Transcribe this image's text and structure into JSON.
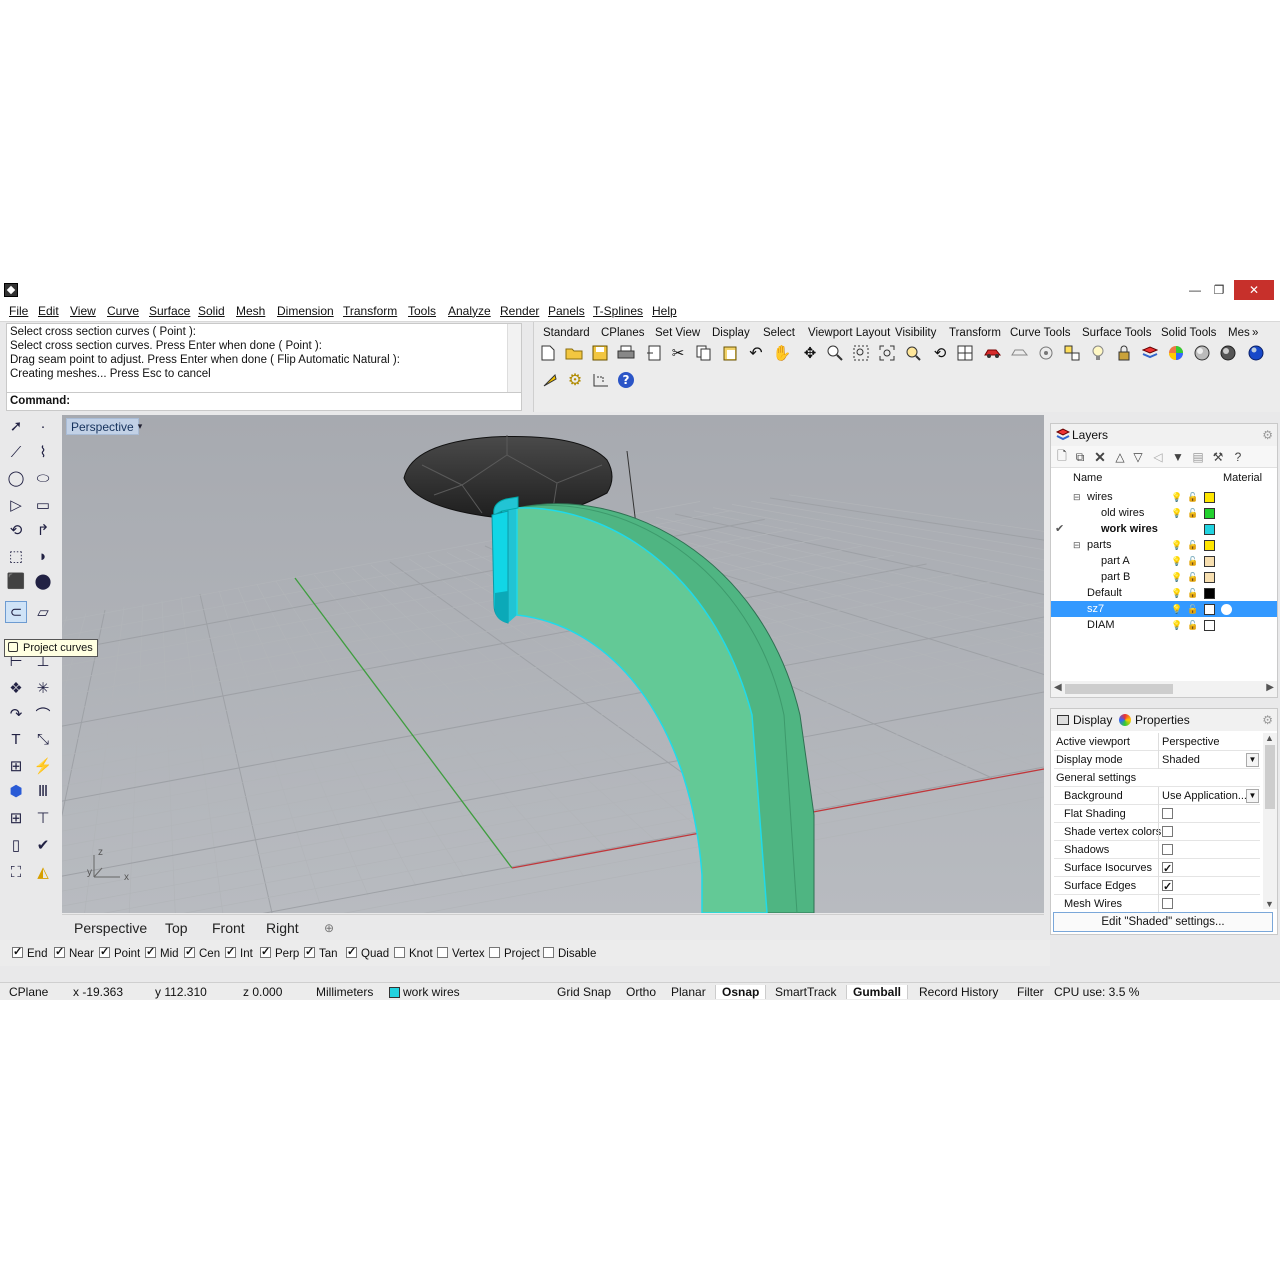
{
  "window": {
    "minimize": "—",
    "restore": "❐",
    "close": "✕"
  },
  "menu": [
    "File",
    "Edit",
    "View",
    "Curve",
    "Surface",
    "Solid",
    "Mesh",
    "Dimension",
    "Transform",
    "Tools",
    "Analyze",
    "Render",
    "Panels",
    "T-Splines",
    "Help"
  ],
  "command_history": [
    "Select cross section curves ( Point ):",
    "Select cross section curves. Press Enter when done ( Point ):",
    "Drag seam point to adjust. Press Enter when done ( Flip  Automatic  Natural ):",
    "Creating meshes... Press Esc to cancel"
  ],
  "command_label": "Command:",
  "toolbar_tabs": [
    "Standard",
    "CPlanes",
    "Set View",
    "Display",
    "Select",
    "Viewport Layout",
    "Visibility",
    "Transform",
    "Curve Tools",
    "Surface Tools",
    "Solid Tools",
    "Mes"
  ],
  "toolbar_more": "»",
  "viewport": {
    "label": "Perspective",
    "dropdown": "▾",
    "axis_z": "z",
    "axis_y": "y",
    "axis_x": "x"
  },
  "tooltip": "Project curves",
  "viewport_tabs": [
    "Perspective",
    "Top",
    "Front",
    "Right"
  ],
  "viewport_tab_add": "⊕",
  "osnaps": [
    {
      "label": "End",
      "checked": true
    },
    {
      "label": "Near",
      "checked": true
    },
    {
      "label": "Point",
      "checked": true
    },
    {
      "label": "Mid",
      "checked": true
    },
    {
      "label": "Cen",
      "checked": true
    },
    {
      "label": "Int",
      "checked": true
    },
    {
      "label": "Perp",
      "checked": true
    },
    {
      "label": "Tan",
      "checked": true
    },
    {
      "label": "Quad",
      "checked": true
    },
    {
      "label": "Knot",
      "checked": false
    },
    {
      "label": "Vertex",
      "checked": false
    },
    {
      "label": "Project",
      "checked": false
    },
    {
      "label": "Disable",
      "checked": false
    }
  ],
  "status": {
    "cplane": "CPlane",
    "x": "x -19.363",
    "y": "y 112.310",
    "z": "z 0.000",
    "units": "Millimeters",
    "layer": "work wires",
    "layer_color": "#22d3e0",
    "grid_snap": "Grid Snap",
    "ortho": "Ortho",
    "planar": "Planar",
    "osnap": "Osnap",
    "smarttrack": "SmartTrack",
    "gumball": "Gumball",
    "record_history": "Record History",
    "filter": "Filter",
    "cpu": "CPU use: 3.5 %"
  },
  "layers_panel": {
    "title": "Layers",
    "col_name": "Name",
    "col_material": "Material",
    "rows": [
      {
        "name": "wires",
        "indent": 1,
        "expander": "⊟",
        "color": "#ffe600",
        "current": false,
        "selected": false,
        "bold": false
      },
      {
        "name": "old wires",
        "indent": 2,
        "expander": "",
        "color": "#22d12e",
        "current": false,
        "selected": false,
        "bold": false
      },
      {
        "name": "work wires",
        "indent": 2,
        "expander": "",
        "color": "#22d3e0",
        "current": true,
        "selected": false,
        "bold": true
      },
      {
        "name": "parts",
        "indent": 1,
        "expander": "⊟",
        "color": "#ffe600",
        "current": false,
        "selected": false,
        "bold": false
      },
      {
        "name": "part A",
        "indent": 2,
        "expander": "",
        "color": "#f7dfb0",
        "current": false,
        "selected": false,
        "bold": false
      },
      {
        "name": "part B",
        "indent": 2,
        "expander": "",
        "color": "#f7dfb0",
        "current": false,
        "selected": false,
        "bold": false
      },
      {
        "name": "Default",
        "indent": 1,
        "expander": "",
        "color": "#000000",
        "current": false,
        "selected": false,
        "bold": false
      },
      {
        "name": "sz7",
        "indent": 1,
        "expander": "",
        "color": "#ffffff",
        "current": false,
        "selected": true,
        "bold": false
      },
      {
        "name": "DIAM",
        "indent": 1,
        "expander": "",
        "color": "#ffffff",
        "current": false,
        "selected": false,
        "bold": false
      }
    ],
    "current_mark": "✔"
  },
  "props_panel": {
    "tab_display": "Display",
    "tab_properties": "Properties",
    "rows": [
      {
        "key": "Active viewport",
        "value": "Perspective",
        "type": "text"
      },
      {
        "key": "Display mode",
        "value": "Shaded",
        "type": "drop"
      },
      {
        "key": "General settings",
        "value": "",
        "type": "section"
      },
      {
        "key": "Background",
        "value": "Use Application...",
        "type": "drop"
      },
      {
        "key": "Flat Shading",
        "value": "",
        "type": "check",
        "checked": false
      },
      {
        "key": "Shade vertex colors",
        "value": "",
        "type": "check",
        "checked": false
      },
      {
        "key": "Shadows",
        "value": "",
        "type": "check",
        "checked": false
      },
      {
        "key": "Surface Isocurves",
        "value": "",
        "type": "check",
        "checked": true
      },
      {
        "key": "Surface Edges",
        "value": "",
        "type": "check",
        "checked": true
      },
      {
        "key": "Mesh Wires",
        "value": "",
        "type": "check",
        "checked": false
      }
    ],
    "edit_button": "Edit \"Shaded\" settings..."
  },
  "colors": {
    "viewport_bg": "#a8acb1",
    "ring_green": "#5ec491",
    "ring_edge_cyan": "#19e0ee",
    "x_axis": "#c0373b",
    "y_axis": "#3f9e3f",
    "gem": "#2e2e2e",
    "selection_blue": "#3399ff"
  }
}
